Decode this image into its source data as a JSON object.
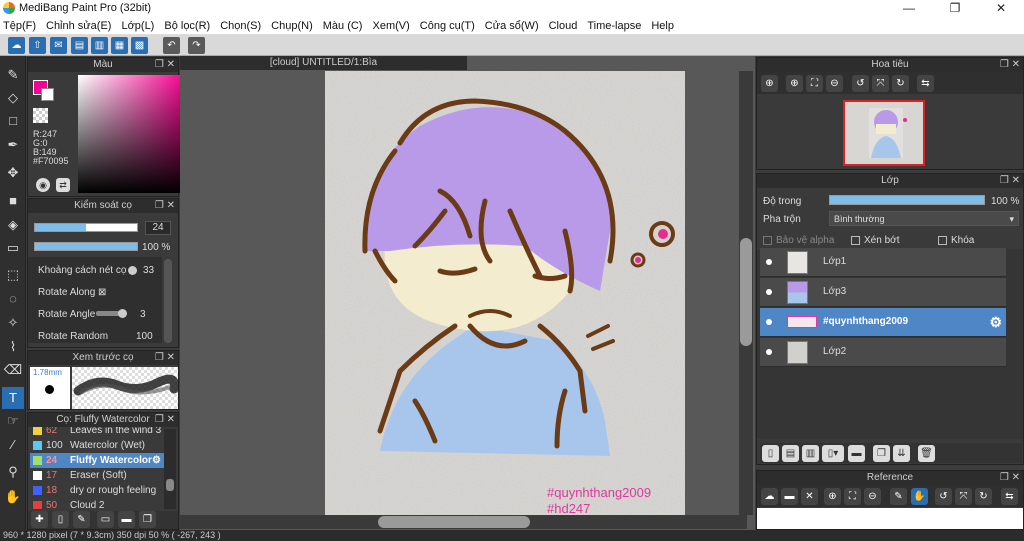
{
  "window": {
    "title": "MediBang Paint Pro (32bit)",
    "controls": [
      "—",
      "❐",
      "✕"
    ]
  },
  "menu": [
    "Tệp(F)",
    "Chỉnh sửa(E)",
    "Lớp(L)",
    "Bộ lọc(R)",
    "Chọn(S)",
    "Chụp(N)",
    "Màu (C)",
    "Xem(V)",
    "Công cụ(T)",
    "Cửa sổ(W)",
    "Cloud",
    "Time-lapse",
    "Help"
  ],
  "color_panel": {
    "title": "Màu",
    "r": "R:247",
    "g": "G:0",
    "b": "B:149",
    "hex": "#F70095",
    "accent": "#f70095"
  },
  "brush_control": {
    "title": "Kiểm soát cọ",
    "size": "24",
    "opacity": "100 %",
    "rows": [
      {
        "label": "Khoảng cách nét cọ",
        "value": "33"
      },
      {
        "label": "Rotate Along",
        "value": "⊠"
      },
      {
        "label": "Rotate Angle",
        "value": "3"
      },
      {
        "label": "Rotate Random",
        "value": "100"
      }
    ]
  },
  "brush_preview": {
    "title": "Xem trước cọ",
    "size": "1.78mm"
  },
  "brush_list": {
    "title": "Cọ: Fluffy Watercolor",
    "items": [
      {
        "num": "62",
        "name": "Leaves in the wind 3",
        "color": "#f0d040",
        "selected": false
      },
      {
        "num": "100",
        "name": "Watercolor (Wet)",
        "color": "#5ac8f0",
        "selected": false
      },
      {
        "num": "24",
        "name": "Fluffy Watercolor",
        "color": "#a0e070",
        "selected": true
      },
      {
        "num": "17",
        "name": "Eraser (Soft)",
        "color": "#ffffff",
        "selected": false
      },
      {
        "num": "18",
        "name": "dry or rough feeling",
        "color": "#4060ff",
        "selected": false
      },
      {
        "num": "50",
        "name": "Cloud 2",
        "color": "#e04040",
        "selected": false
      }
    ]
  },
  "canvas": {
    "tab": "[cloud] UNTITLED/1:Bìa",
    "watermark1": "#quynhthang2009",
    "watermark2": "#hd247"
  },
  "navigator": {
    "title": "Hoa tiêu"
  },
  "layers": {
    "title": "Lớp",
    "opacity_label": "Độ trong",
    "opacity_value": "100 %",
    "blend_label": "Pha trộn",
    "blend_value": "Bình thường",
    "protect_alpha": "Bảo vệ alpha",
    "clipping": "Xén bớt",
    "lock": "Khóa",
    "items": [
      {
        "name": "Lớp1",
        "selected": false
      },
      {
        "name": "Lớp3",
        "selected": false
      },
      {
        "name": "#quynhthang2009",
        "selected": true
      },
      {
        "name": "Lớp2",
        "selected": false
      }
    ]
  },
  "reference": {
    "title": "Reference"
  },
  "status": "960 * 1280 pixel   (7 * 9.3cm)   350 dpi   50 %   ( -267, 243 )"
}
